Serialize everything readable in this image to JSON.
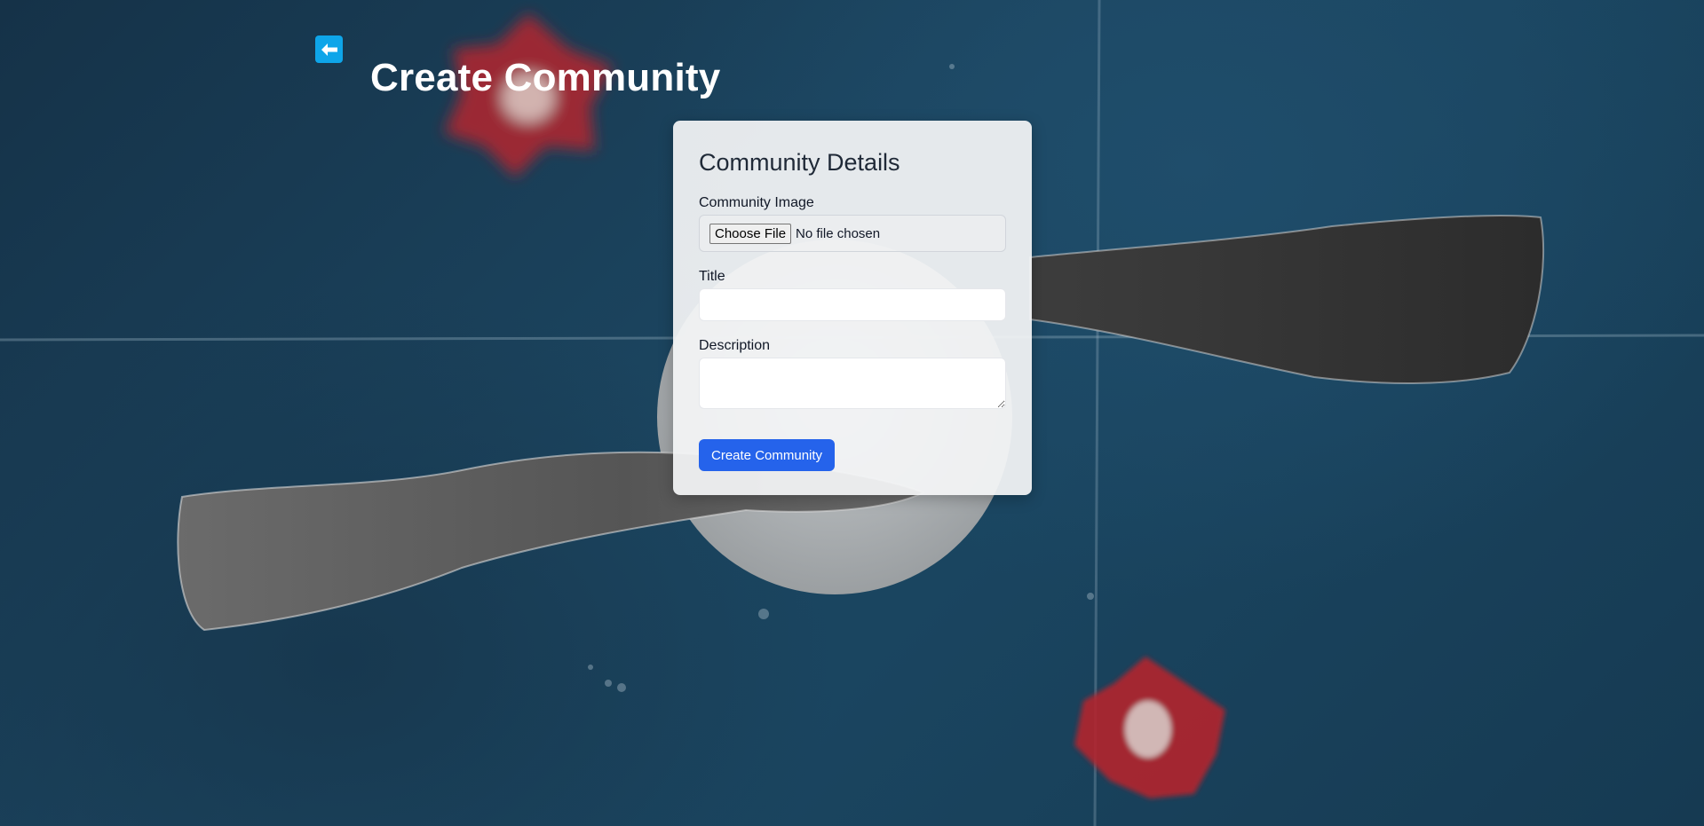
{
  "header": {
    "back_icon": "arrow-left-icon",
    "title": "Create Community"
  },
  "form": {
    "heading": "Community Details",
    "image_label": "Community Image",
    "choose_file_label": "Choose File",
    "file_status": "No file chosen",
    "title_label": "Title",
    "title_value": "",
    "description_label": "Description",
    "description_value": "",
    "submit_label": "Create Community"
  },
  "colors": {
    "back_button": "#0ea5e9",
    "submit_button": "#2563eb",
    "background": "#1c4661"
  }
}
